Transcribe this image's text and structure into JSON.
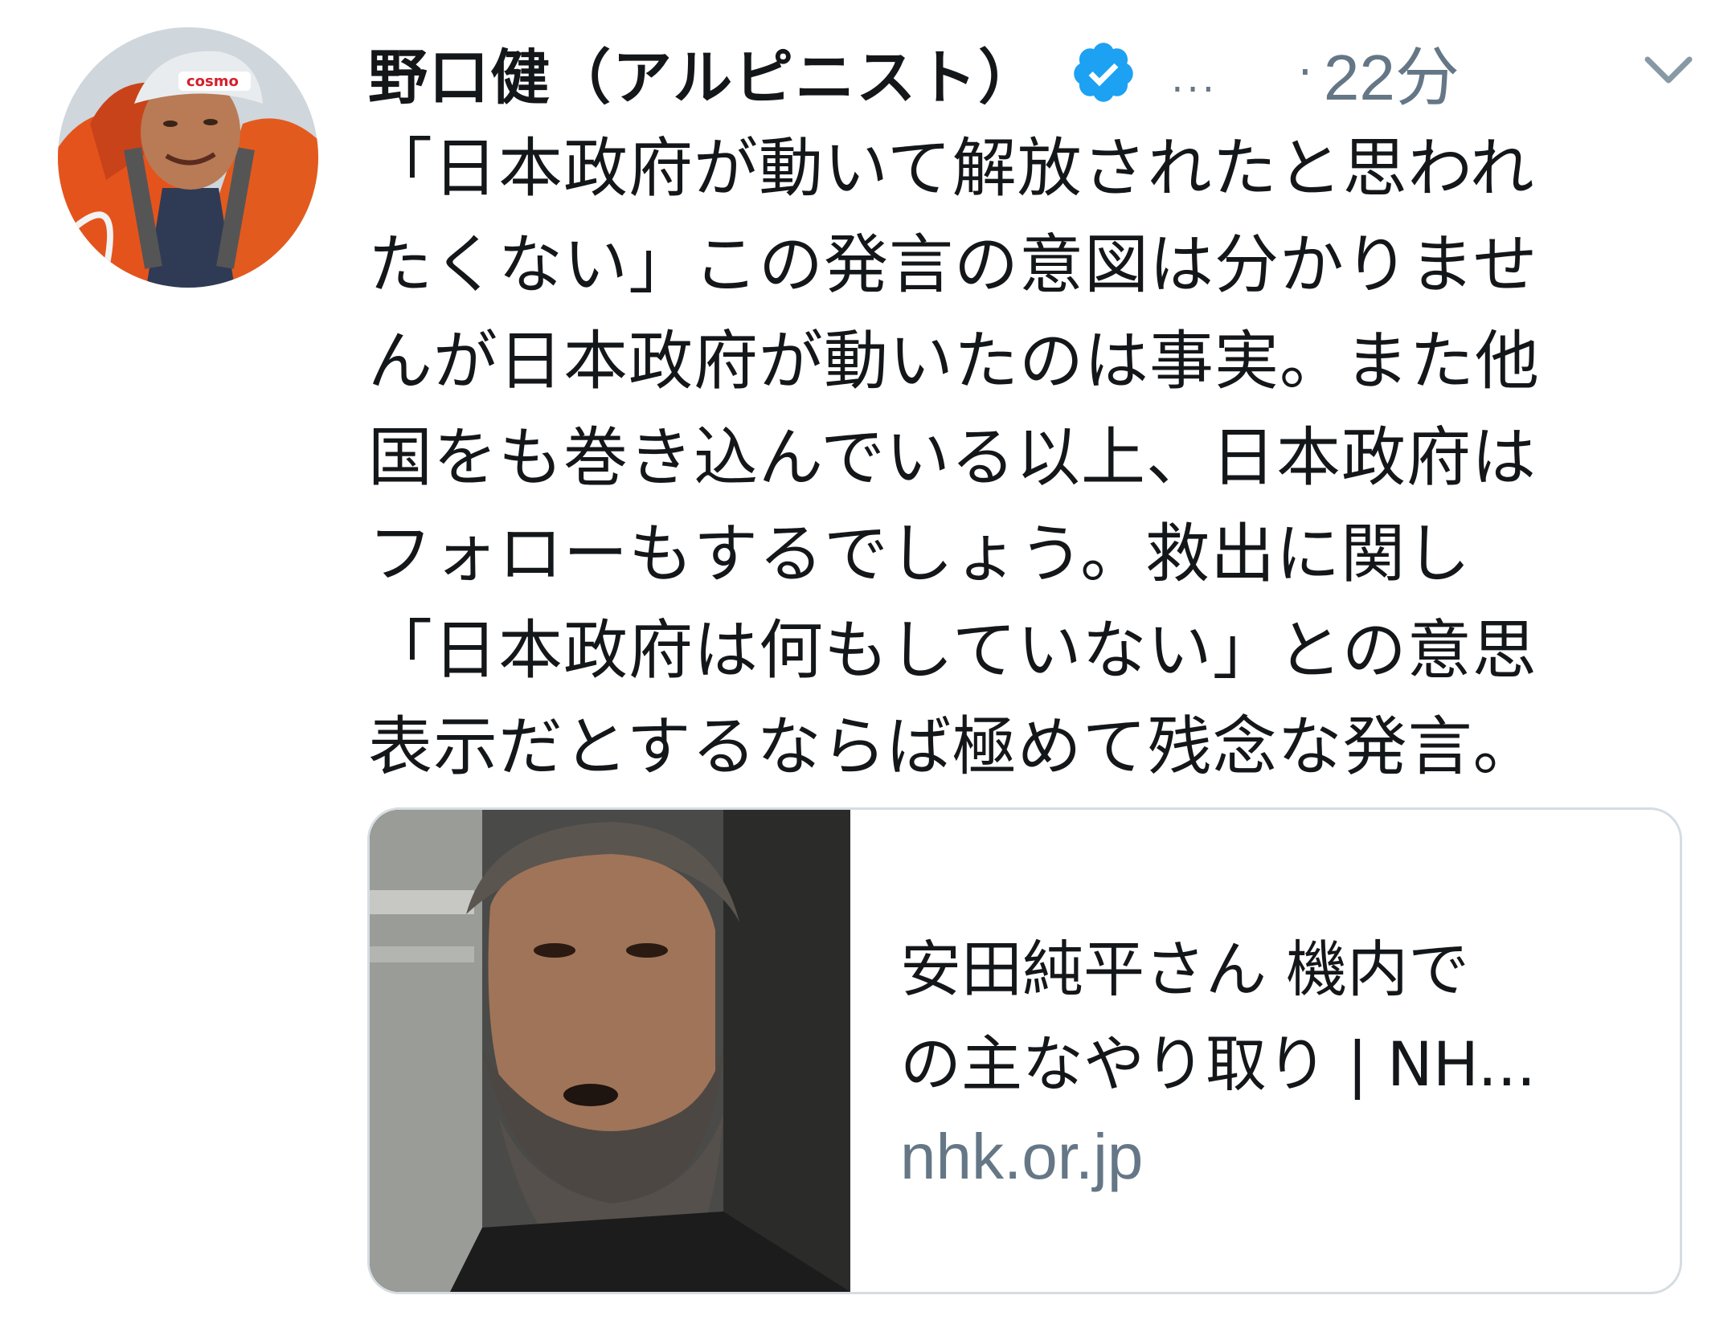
{
  "tweet": {
    "author": {
      "display_name": "野口健（アルピニスト）",
      "handle": "...",
      "verified": true,
      "avatar_icon": "avatar-climber-photo"
    },
    "separator": "·",
    "timestamp": "22分",
    "menu_icon": "chevron-down-icon",
    "text_lines": [
      "「日本政府が動いて解放されたと思われ",
      "たくない」この発言の意図は分かりませ",
      "んが日本政府が動いたのは事実。また他",
      "国をも巻き込んでいる以上、日本政府は",
      "フォローもするでしょう。救出に関し",
      "「日本政府は何もしていない」との意思",
      "表示だとするならば極めて残念な発言。"
    ],
    "link_card": {
      "title_lines": [
        "安田純平さん 機内で",
        "の主なやり取り | NH..."
      ],
      "domain": "nhk.or.jp",
      "thumbnail_icon": "news-photo-thumbnail"
    }
  },
  "colors": {
    "text_primary": "#14171a",
    "text_secondary": "#657786",
    "verified_blue": "#1da1f2",
    "card_border": "#d5dde3"
  }
}
